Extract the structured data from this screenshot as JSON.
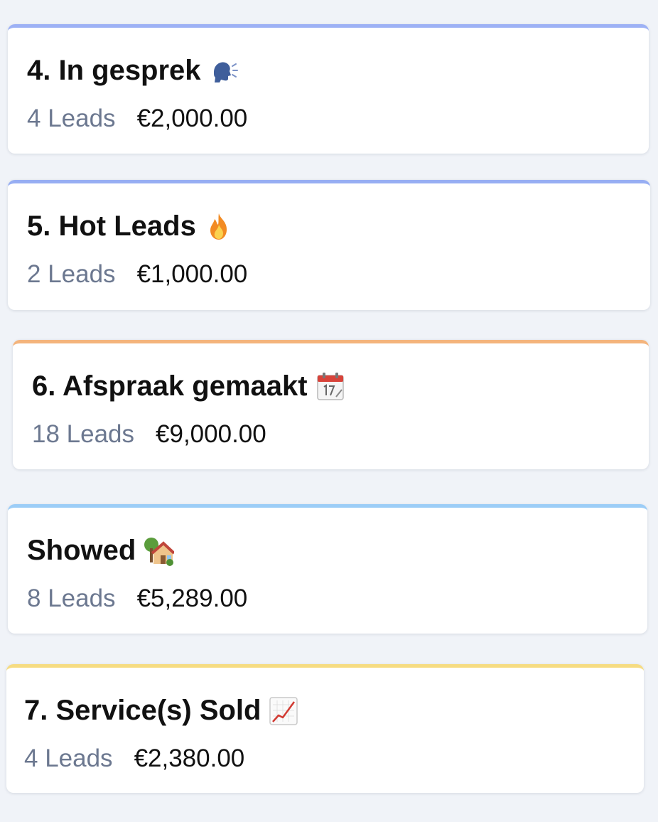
{
  "stages": [
    {
      "title": "4. In gesprek",
      "icon": "speaking-head-icon",
      "leads": "4 Leads",
      "value": "€2,000.00",
      "accent": "#9db1f5"
    },
    {
      "title": "5. Hot Leads",
      "icon": "fire-icon",
      "leads": "2 Leads",
      "value": "€1,000.00",
      "accent": "#97aef3"
    },
    {
      "title": "6. Afspraak gemaakt",
      "icon": "calendar-icon",
      "leads": "18 Leads",
      "value": "€9,000.00",
      "accent": "#f4b47c"
    },
    {
      "title": "Showed",
      "icon": "house-with-garden-icon",
      "leads": "8 Leads",
      "value": "€5,289.00",
      "accent": "#9ccdf7"
    },
    {
      "title": "7. Service(s) Sold",
      "icon": "chart-increasing-icon",
      "leads": "4 Leads",
      "value": "€2,380.00",
      "accent": "#f6dc82"
    }
  ]
}
